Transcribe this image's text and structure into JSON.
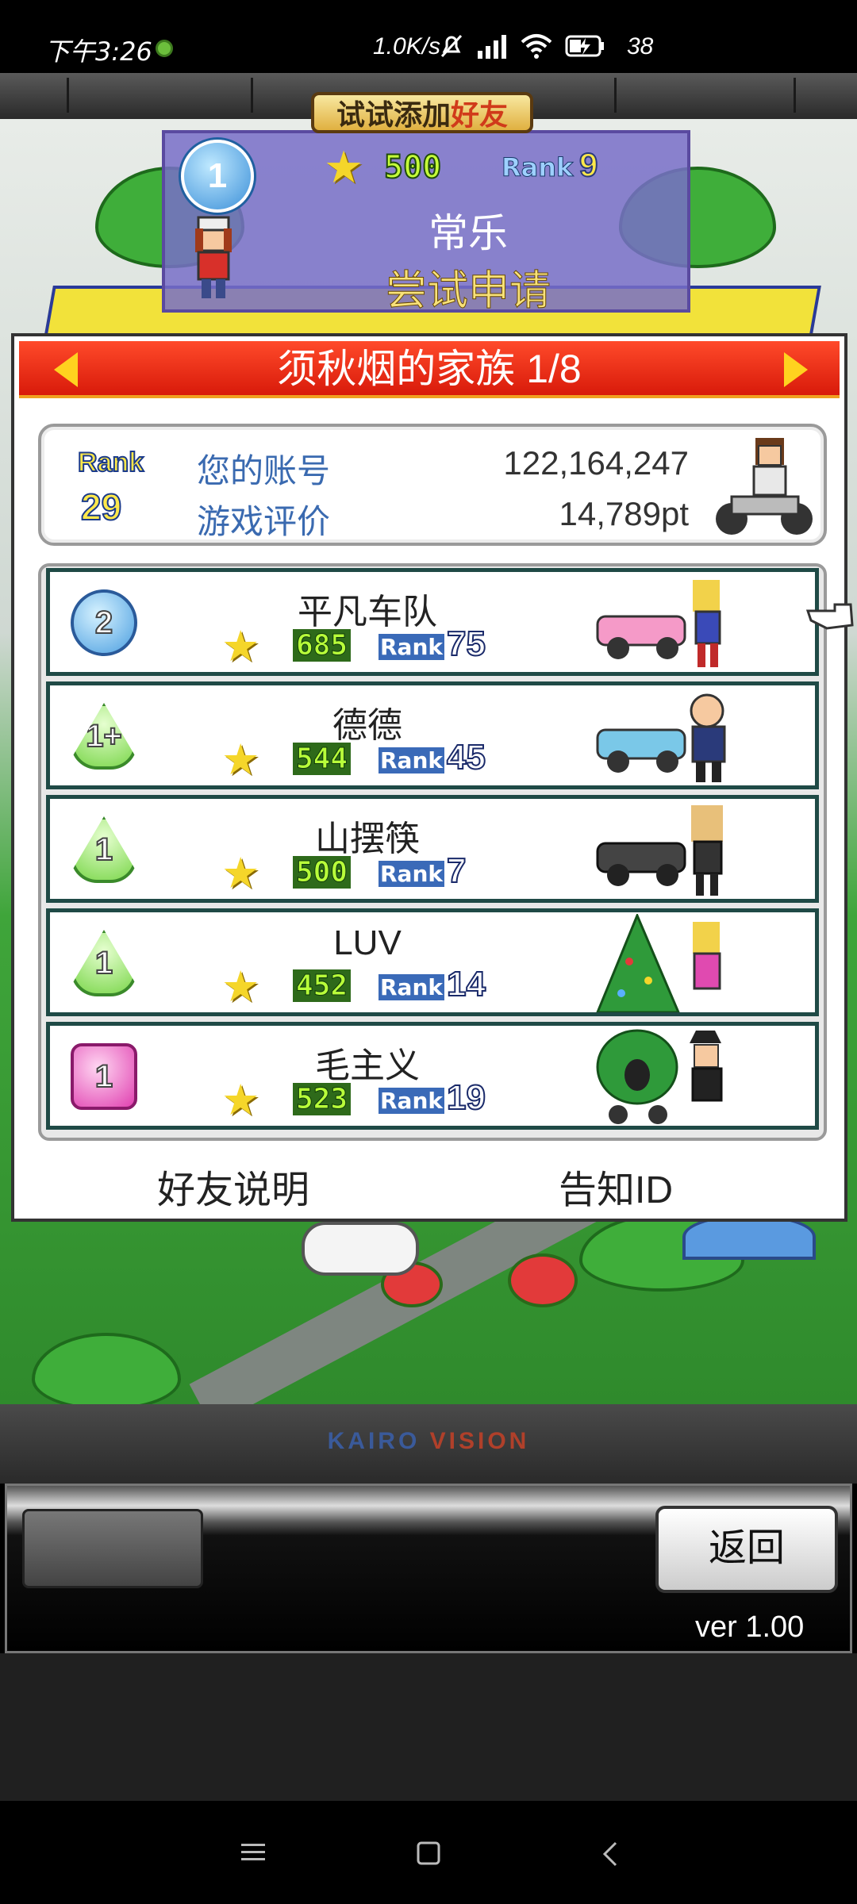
{
  "status_bar": {
    "time": "下午3:26",
    "net_speed": "1.0K/s",
    "battery": "38"
  },
  "profile": {
    "try_add_prefix": "试试添加",
    "try_add_highlight": "好友",
    "medal": "1",
    "score": "500",
    "rank_label": "Rank",
    "rank_value": "9",
    "name": "常乐",
    "action": "尝试申请"
  },
  "panel": {
    "title": "须秋烟的家族 1/8",
    "rank_label": "Rank",
    "rank_value": "29",
    "account_label": "您的账号",
    "account_value": "122,164,247",
    "rating_label": "游戏评价",
    "rating_value": "14,789pt"
  },
  "friends": [
    {
      "medal": "2",
      "medal_style": "circle",
      "name": "平凡车队",
      "score": "685",
      "rank_label": "Rank",
      "rank": "75"
    },
    {
      "medal": "1+",
      "medal_style": "green",
      "name": "德德",
      "score": "544",
      "rank_label": "Rank",
      "rank": "45"
    },
    {
      "medal": "1",
      "medal_style": "green",
      "name": "山摆筷",
      "score": "500",
      "rank_label": "Rank",
      "rank": "7"
    },
    {
      "medal": "1",
      "medal_style": "green",
      "name": "LUV",
      "score": "452",
      "rank_label": "Rank",
      "rank": "14"
    },
    {
      "medal": "1",
      "medal_style": "pink",
      "name": "毛主义",
      "score": "523",
      "rank_label": "Rank",
      "rank": "19"
    }
  ],
  "footer": {
    "friend_info": "好友说明",
    "notify_id": "告知ID"
  },
  "bottom": {
    "brand_a": "KAIRO",
    "brand_b": "VISION",
    "back": "返回",
    "version": "ver 1.00"
  },
  "colors": {
    "header_red": "#e8200e",
    "account_blue": "#3a6ab0",
    "row_border": "#1f4a46"
  }
}
